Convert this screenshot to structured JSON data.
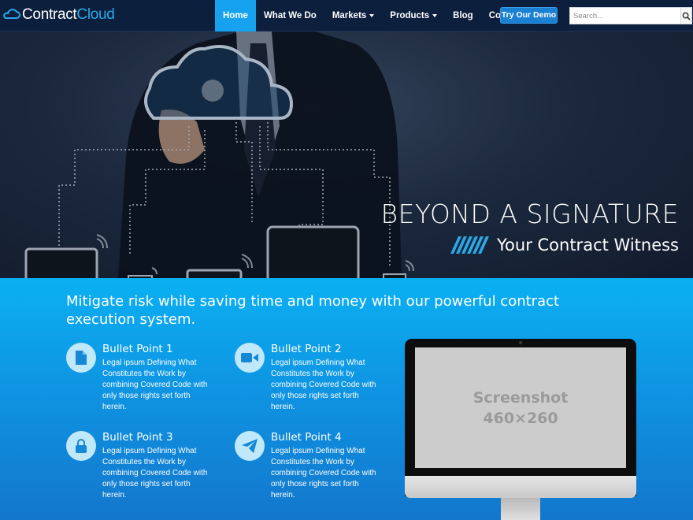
{
  "brand": {
    "name_part1": "Contract",
    "name_part2": "Cloud",
    "icon": "cloud-logo-icon",
    "accent": "#2aa9e8"
  },
  "nav": {
    "items": [
      {
        "label": "Home",
        "active": true
      },
      {
        "label": "What We Do"
      },
      {
        "label": "Markets",
        "dropdown": true
      },
      {
        "label": "Products",
        "dropdown": true
      },
      {
        "label": "Blog"
      },
      {
        "label": "Contact"
      }
    ],
    "demo_button": "Try Our Demo",
    "search_placeholder": "Search...",
    "search_icon": "search-icon"
  },
  "hero": {
    "title": "BEYOND A SIGNATURE",
    "subtitle": "Your Contract Witness"
  },
  "features": {
    "lead": "Mitigate risk while saving time and money with our powerful contract execution system.",
    "bullets": [
      {
        "title": "Bullet Point 1",
        "text": "Legal ipsum Defining What Constitutes the Work by combining Covered Code with only those rights set forth herein.",
        "icon": "document-icon"
      },
      {
        "title": "Bullet Point 2",
        "text": "Legal ipsum Defining What Constitutes the Work by combining Covered Code with only those rights set forth herein.",
        "icon": "video-camera-icon"
      },
      {
        "title": "Bullet Point 3",
        "text": "Legal ipsum Defining What Constitutes the Work by combining Covered Code with only those rights set forth herein.",
        "icon": "lock-icon"
      },
      {
        "title": "Bullet Point 4",
        "text": "Legal ipsum Defining What Constitutes the Work by combining Covered Code with only those rights set forth herein.",
        "icon": "paper-plane-icon"
      }
    ]
  },
  "screenshot": {
    "line1": "Screenshot",
    "line2": "460×260"
  },
  "colors": {
    "nav_bg": "#0c1f3d",
    "active_nav": "#16a2ef",
    "section_top": "#0bb0f3",
    "section_bottom": "#1377cc",
    "icon_circle": "#bfe8fb",
    "icon_fg": "#1588d6"
  }
}
